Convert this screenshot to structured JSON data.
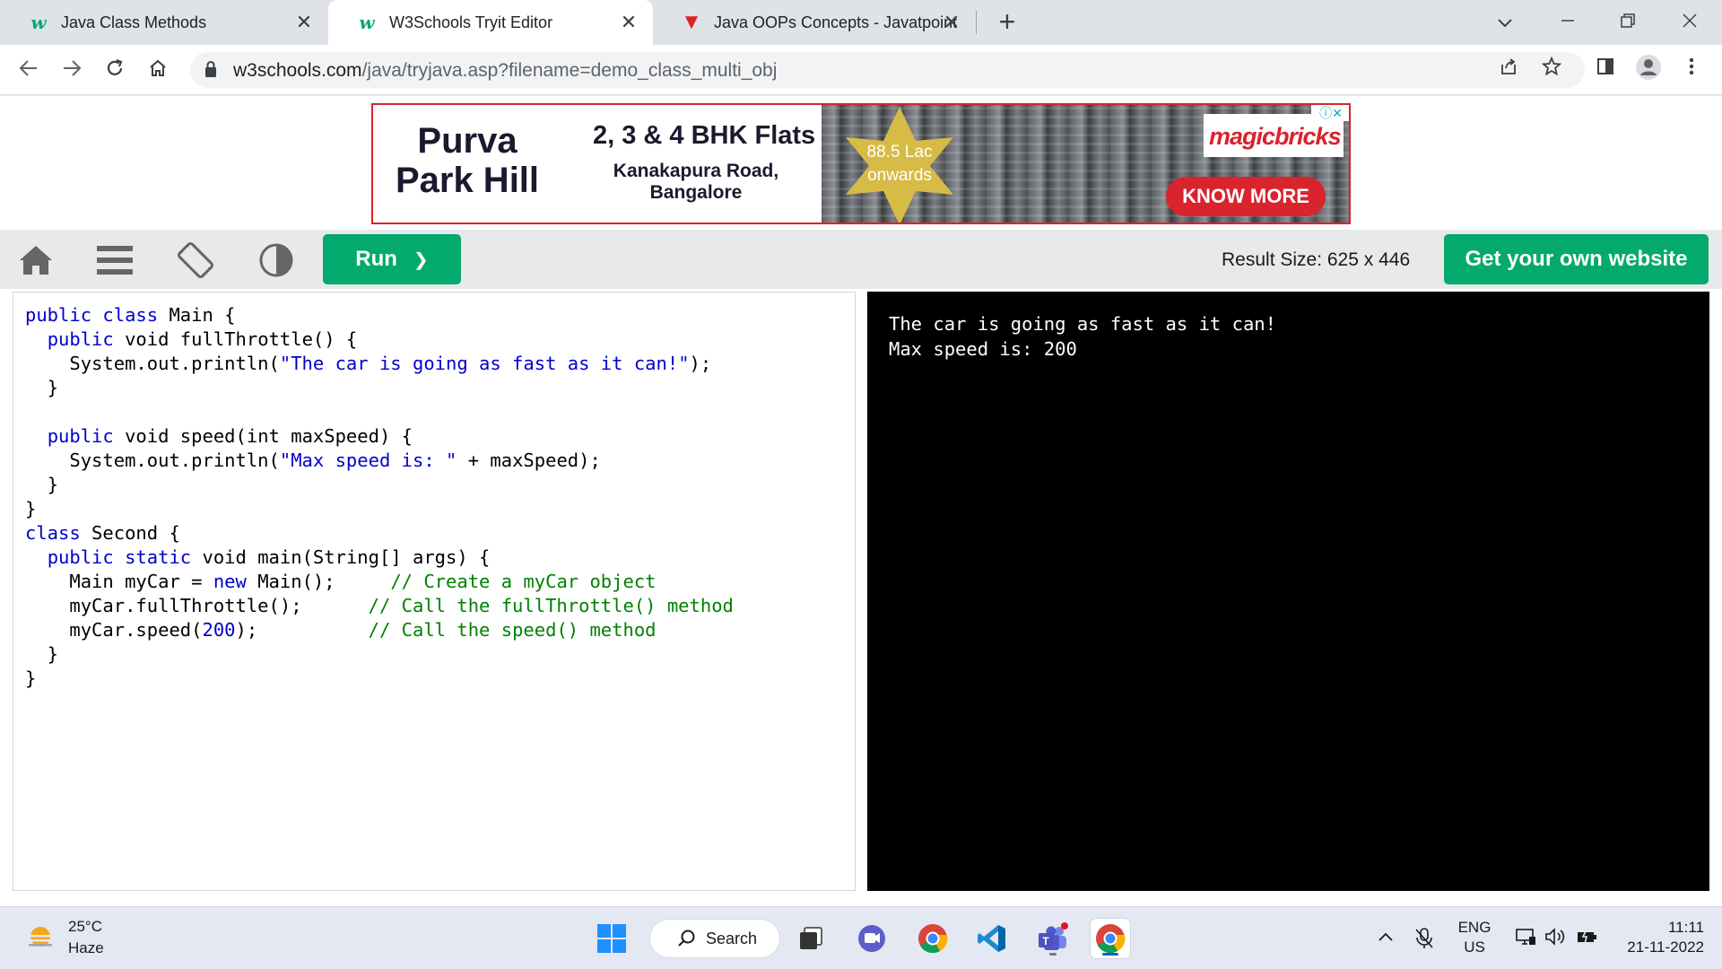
{
  "browser": {
    "tabs": [
      {
        "title": "Java Class Methods",
        "favicon": "w3schools-icon",
        "active": false
      },
      {
        "title": "W3Schools Tryit Editor",
        "favicon": "w3schools-icon",
        "active": true
      },
      {
        "title": "Java OOPs Concepts - Javatpoint",
        "favicon": "javatpoint-icon",
        "active": false
      }
    ],
    "new_tab_symbol": "+",
    "url_host": "w3schools.com",
    "url_path": "/java/tryjava.asp?filename=demo_class_multi_obj"
  },
  "ad": {
    "project_line1": "Purva",
    "project_line2": "Park Hill",
    "headline": "2, 3 & 4 BHK Flats",
    "location_line1": "Kanakapura Road,",
    "location_line2": "Bangalore",
    "price_line1": "88.5 Lac",
    "price_line2": "onwards",
    "brand": "magicbricks",
    "cta": "KNOW MORE"
  },
  "tryit": {
    "run_label": "Run",
    "run_chevron": "❯",
    "result_size": "Result Size: 625 x 446",
    "get_website_label": "Get your own website"
  },
  "output": {
    "lines": [
      "The car is going as fast as it can!",
      "Max speed is: 200"
    ]
  },
  "taskbar": {
    "temperature": "25°C",
    "condition": "Haze",
    "search_label": "Search",
    "lang_line1": "ENG",
    "lang_line2": "US",
    "time": "11:11",
    "date": "21-11-2022"
  },
  "colors": {
    "w3_green": "#04aa6d",
    "ad_red": "#d9232d",
    "code_keyword": "#0000cd",
    "code_comment": "#008000"
  }
}
